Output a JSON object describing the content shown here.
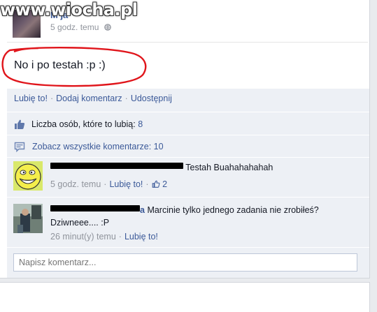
{
  "watermark": {
    "text": "www.wiocha.pl"
  },
  "post": {
    "author": "M  ja",
    "time": "5 godz. temu",
    "text": "No i po testah :p :)"
  },
  "actions": {
    "like": "Lubię to!",
    "comment": "Dodaj komentarz",
    "share": "Udostępnij"
  },
  "likes": {
    "label": "Liczba osób, które to lubią:",
    "count": "8"
  },
  "view_comments": "Zobacz wszystkie komentarze: 10",
  "comments": [
    {
      "avatar_icon": "troll-face-avatar",
      "text": "Testah Buahahahahah",
      "time": "5 godz. temu",
      "like": "Lubię to!",
      "like_count": "2"
    },
    {
      "avatar_icon": "person-photo-avatar",
      "name_suffix": "a",
      "text": "Marcinie tylko jednego zadania nie zrobiłeś? Dziwneee.... :P",
      "time": "26 minut(y) temu",
      "like": "Lubię to!"
    }
  ],
  "comment_input": {
    "placeholder": "Napisz komentarz..."
  },
  "colors": {
    "link": "#3b5998",
    "panel": "#edf0f5",
    "annotation": "#e0151b"
  }
}
